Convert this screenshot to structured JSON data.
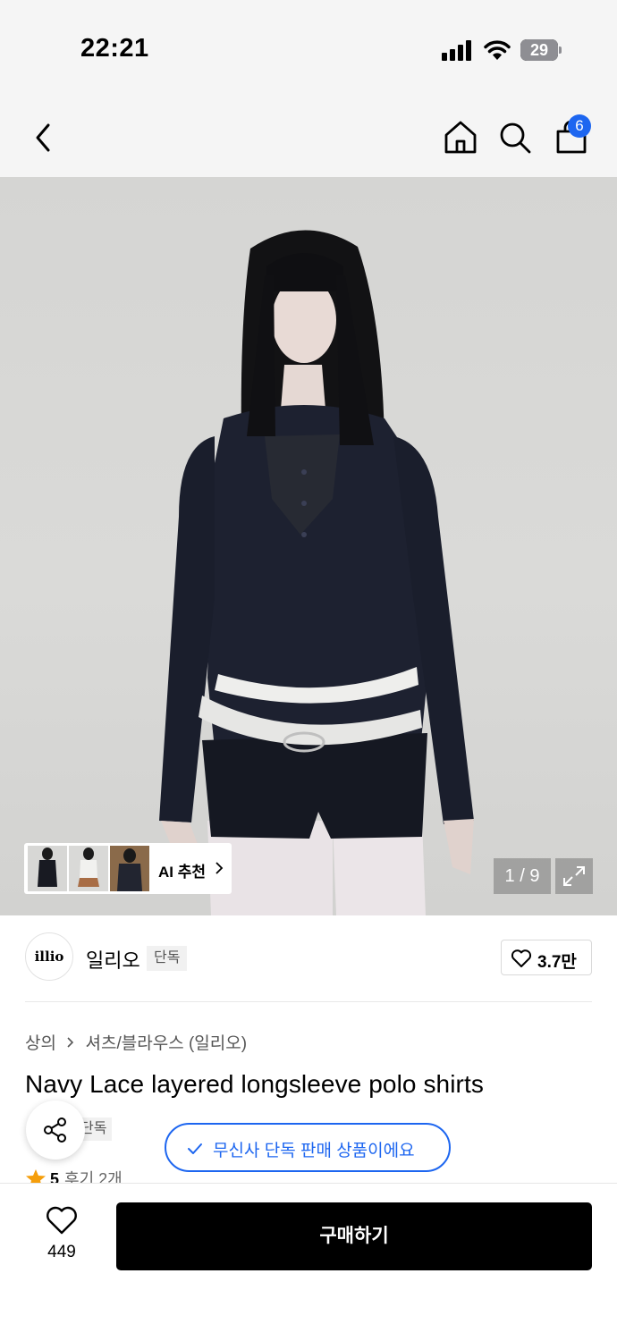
{
  "status_bar": {
    "time": "22:21",
    "battery": "29"
  },
  "header": {
    "cart_count": "6"
  },
  "gallery": {
    "ai_label": "AI 추천",
    "page_counter": "1 / 9"
  },
  "brand": {
    "logo_text": "illio",
    "name": "일리오",
    "tag": "단독",
    "like_count": "3.7만"
  },
  "product": {
    "breadcrumb": [
      "상의",
      "셔츠/블라우스 (일리오)"
    ],
    "title": "Navy Lace layered longsleeve polo shirts",
    "exclusive_tag": "단독",
    "verify_text": "무신사 단독 판매 상품이에요",
    "rating": "5",
    "reviews": "후기 2개"
  },
  "bottom_bar": {
    "wish_count": "449",
    "buy_label": "구매하기"
  },
  "colors": {
    "accent": "#1d66f0",
    "buy_button": "#000000",
    "rating_star": "#f59e0b"
  }
}
